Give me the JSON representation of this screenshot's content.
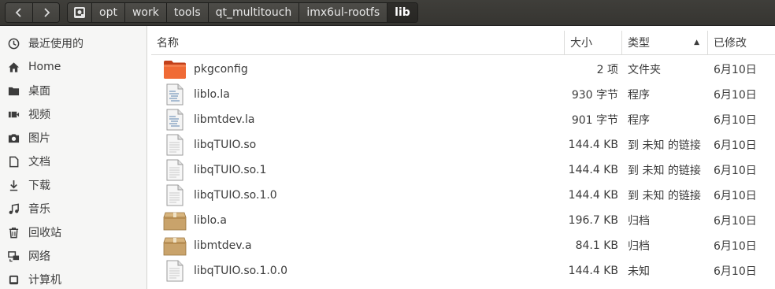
{
  "breadcrumbs": [
    {
      "label": "opt"
    },
    {
      "label": "work"
    },
    {
      "label": "tools"
    },
    {
      "label": "qt_multitouch"
    },
    {
      "label": "imx6ul-rootfs"
    },
    {
      "label": "lib",
      "active": true
    }
  ],
  "sidebar": {
    "items": [
      {
        "label": "最近使用的",
        "icon": "clock-icon"
      },
      {
        "label": "Home",
        "icon": "home-icon"
      },
      {
        "label": "桌面",
        "icon": "folder-icon"
      },
      {
        "label": "视频",
        "icon": "video-icon"
      },
      {
        "label": "图片",
        "icon": "camera-icon"
      },
      {
        "label": "文档",
        "icon": "document-icon"
      },
      {
        "label": "下载",
        "icon": "download-icon"
      },
      {
        "label": "音乐",
        "icon": "music-icon"
      },
      {
        "label": "回收站",
        "icon": "trash-icon"
      },
      {
        "label": "网络",
        "icon": "network-icon"
      },
      {
        "label": "计算机",
        "icon": "computer-icon"
      }
    ]
  },
  "columns": {
    "name": "名称",
    "size": "大小",
    "type": "类型",
    "modified": "已修改"
  },
  "files": [
    {
      "name": "pkgconfig",
      "size": "2 项",
      "type": "文件夹",
      "modified": "6月10日",
      "icon": "folder-icon"
    },
    {
      "name": "liblo.la",
      "size": "930 字节",
      "type": "程序",
      "modified": "6月10日",
      "icon": "script-file-icon"
    },
    {
      "name": "libmtdev.la",
      "size": "901 字节",
      "type": "程序",
      "modified": "6月10日",
      "icon": "script-file-icon"
    },
    {
      "name": "libqTUIO.so",
      "size": "144.4 KB",
      "type": "到 未知 的链接",
      "modified": "6月10日",
      "icon": "file-icon"
    },
    {
      "name": "libqTUIO.so.1",
      "size": "144.4 KB",
      "type": "到 未知 的链接",
      "modified": "6月10日",
      "icon": "file-icon"
    },
    {
      "name": "libqTUIO.so.1.0",
      "size": "144.4 KB",
      "type": "到 未知 的链接",
      "modified": "6月10日",
      "icon": "file-icon"
    },
    {
      "name": "liblo.a",
      "size": "196.7 KB",
      "type": "归档",
      "modified": "6月10日",
      "icon": "archive-icon"
    },
    {
      "name": "libmtdev.a",
      "size": "84.1 KB",
      "type": "归档",
      "modified": "6月10日",
      "icon": "archive-icon"
    },
    {
      "name": "libqTUIO.so.1.0.0",
      "size": "144.4 KB",
      "type": "未知",
      "modified": "6月10日",
      "icon": "file-icon"
    }
  ],
  "colors": {
    "headerbar": "#3f3e3a",
    "folder": "#e95420",
    "archive": "#c9a36b"
  }
}
